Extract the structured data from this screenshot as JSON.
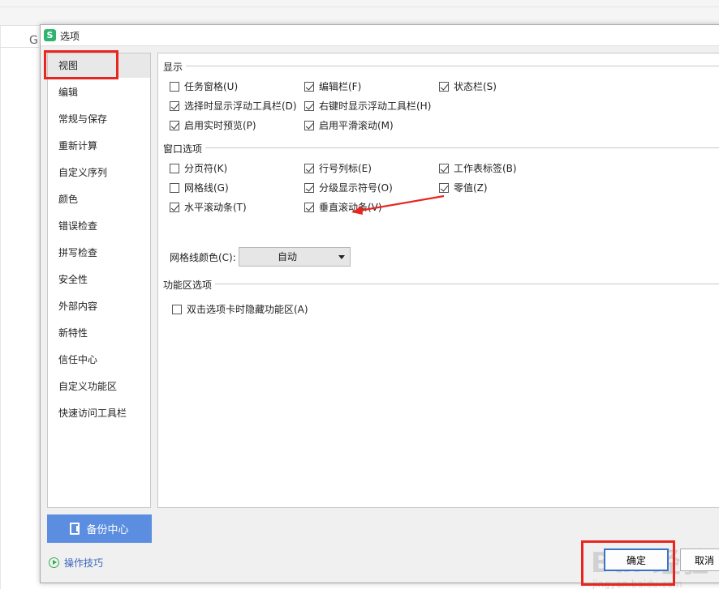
{
  "background": {
    "column_label": "G"
  },
  "dialog": {
    "title": "选项",
    "app_icon_letter": "S",
    "nav": {
      "items": [
        {
          "label": "视图",
          "active": true
        },
        {
          "label": "编辑"
        },
        {
          "label": "常规与保存"
        },
        {
          "label": "重新计算"
        },
        {
          "label": "自定义序列"
        },
        {
          "label": "颜色"
        },
        {
          "label": "错误检查"
        },
        {
          "label": "拼写检查"
        },
        {
          "label": "安全性"
        },
        {
          "label": "外部内容"
        },
        {
          "label": "新特性"
        },
        {
          "label": "信任中心"
        },
        {
          "label": "自定义功能区"
        },
        {
          "label": "快速访问工具栏"
        }
      ]
    },
    "backup_button": "备份中心",
    "tips_link": "操作技巧",
    "sections": {
      "display": {
        "title": "显示",
        "options": [
          {
            "label": "任务窗格(U)",
            "checked": false
          },
          {
            "label": "编辑栏(F)",
            "checked": true
          },
          {
            "label": "状态栏(S)",
            "checked": true
          },
          {
            "label": "选择时显示浮动工具栏(D)",
            "checked": true
          },
          {
            "label": "右键时显示浮动工具栏(H)",
            "checked": true
          },
          {
            "label": "启用实时预览(P)",
            "checked": true
          },
          {
            "label": "启用平滑滚动(M)",
            "checked": true
          }
        ]
      },
      "window": {
        "title": "窗口选项",
        "options": [
          {
            "label": "分页符(K)",
            "checked": false
          },
          {
            "label": "行号列标(E)",
            "checked": true
          },
          {
            "label": "工作表标签(B)",
            "checked": true
          },
          {
            "label": "网格线(G)",
            "checked": false
          },
          {
            "label": "分级显示符号(O)",
            "checked": true
          },
          {
            "label": "零值(Z)",
            "checked": true
          },
          {
            "label": "水平滚动条(T)",
            "checked": true
          },
          {
            "label": "垂直滚动条(V)",
            "checked": true
          }
        ],
        "grid_color_label": "网格线颜色(C):",
        "grid_color_value": "自动"
      },
      "ribbon": {
        "title": "功能区选项",
        "options": [
          {
            "label": "双击选项卡时隐藏功能区(A)",
            "checked": false
          }
        ]
      }
    },
    "ok_button": "确定",
    "cancel_button": "取消"
  },
  "watermark": {
    "main": "Bai 经验",
    "sub": "jingyan.baidu.com"
  },
  "colors": {
    "highlight_red": "#e8261f",
    "backup_blue": "#5b8ee0",
    "ok_border": "#3a72c8",
    "app_green": "#2db46e"
  }
}
